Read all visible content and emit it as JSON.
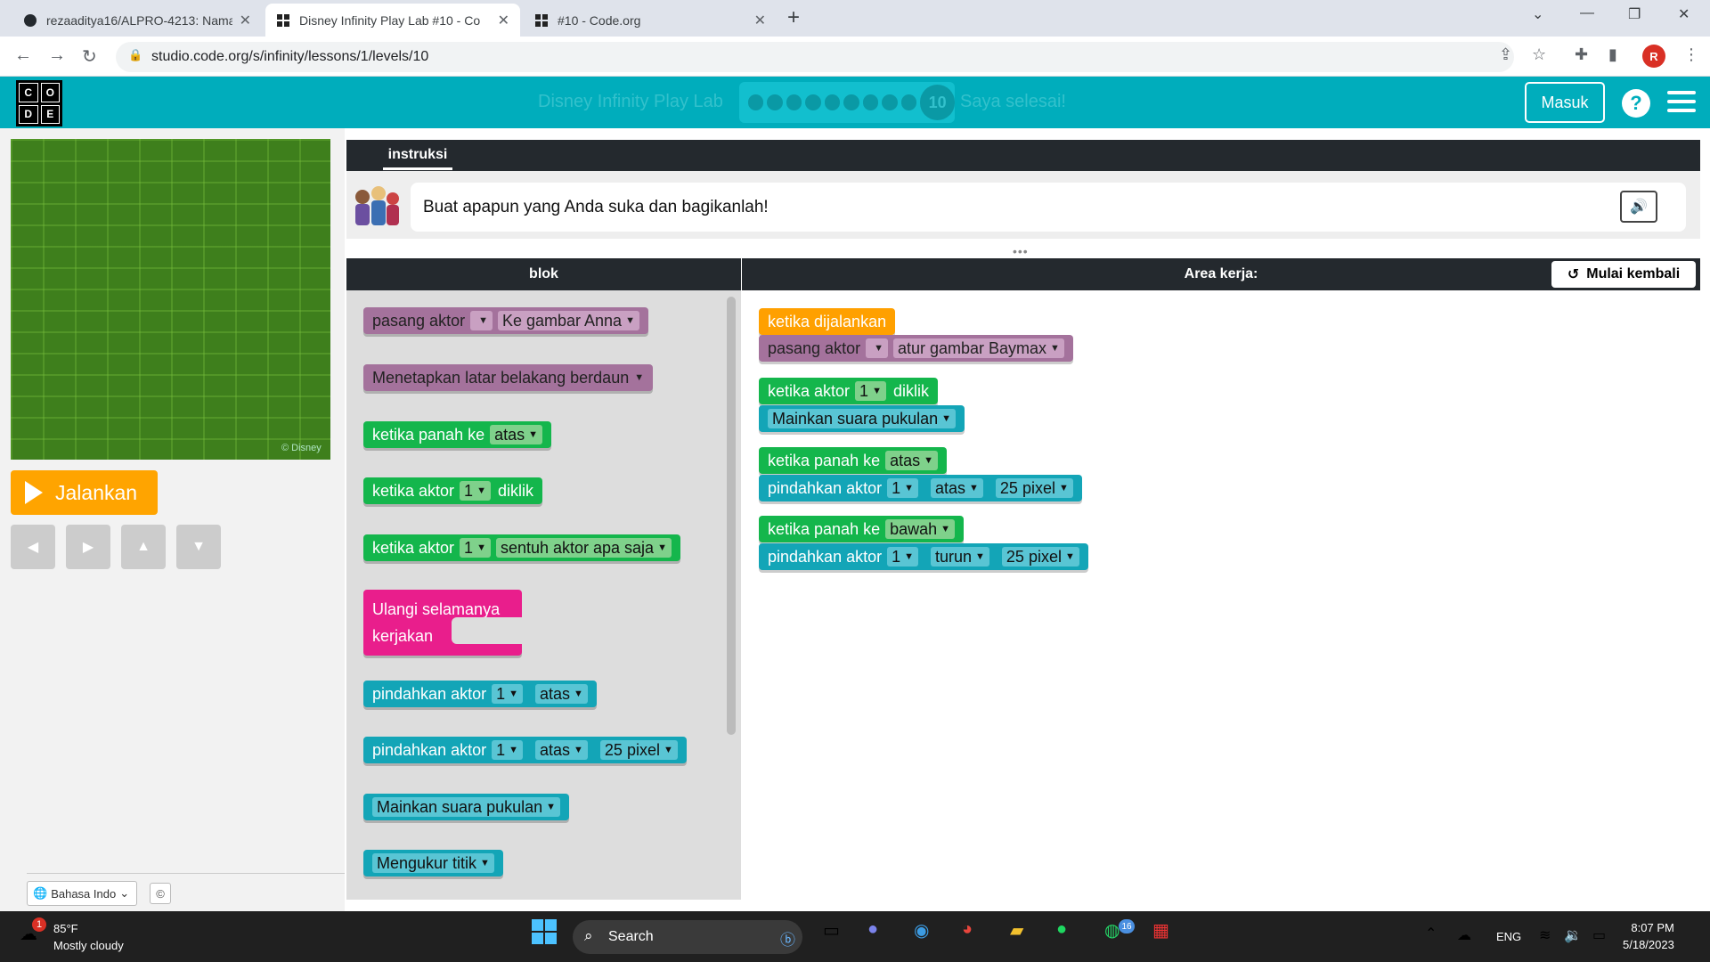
{
  "browser": {
    "tabs": [
      {
        "title": "rezaaditya16/ALPRO-4213: Nama",
        "icon": "github-icon",
        "active": false
      },
      {
        "title": "Disney Infinity Play Lab #10 - Co",
        "icon": "code-org-icon",
        "active": true
      },
      {
        "title": "#10 - Code.org",
        "icon": "code-org-icon",
        "active": false
      }
    ],
    "url": "studio.code.org/s/infinity/lessons/1/levels/10",
    "profile_initial": "R"
  },
  "header": {
    "logo_letters": [
      "C",
      "O",
      "D",
      "E"
    ],
    "level_title": "Disney Infinity Play Lab",
    "current_level": "10",
    "finished_label": "Saya selesai!",
    "signin_label": "Masuk",
    "help_label": "?"
  },
  "left": {
    "stage_credit": "© Disney",
    "run_label": "Jalankan",
    "language": "Bahasa Indo",
    "copyright_icon": "©"
  },
  "instructions": {
    "tab_label": "instruksi",
    "text": "Buat apapun yang Anda suka dan bagikanlah!"
  },
  "toolbox": {
    "title": "blok",
    "blocks": [
      {
        "color": "purple",
        "text": "pasang aktor",
        "slots": [
          "",
          "Ke gambar Anna"
        ]
      },
      {
        "color": "purple",
        "text": "Menetapkan latar belakang berdaun",
        "slots": []
      },
      {
        "color": "green",
        "text": "ketika  panah ke",
        "slots": [
          "atas"
        ]
      },
      {
        "color": "green",
        "text": "ketika aktor",
        "slots": [
          "1",
          "diklik"
        ]
      },
      {
        "color": "green",
        "text": "ketika aktor",
        "slots": [
          "1",
          "sentuh aktor apa saja"
        ]
      },
      {
        "color": "pink",
        "text": "Ulangi selamanya",
        "text2": "kerjakan",
        "slots": []
      },
      {
        "color": "teal",
        "text": "pindahkan aktor",
        "slots": [
          "1",
          "atas"
        ]
      },
      {
        "color": "teal",
        "text": "pindahkan aktor",
        "slots": [
          "1",
          "atas",
          "25 pixel"
        ]
      },
      {
        "color": "teal",
        "text": "Mainkan suara pukulan",
        "slots": []
      },
      {
        "color": "teal",
        "text": "Mengukur titik",
        "slots": []
      }
    ]
  },
  "workspace": {
    "title": "Area kerja:",
    "reset_label": "Mulai kembali",
    "blocks": [
      {
        "head": "ketika dijalankan",
        "body": "pasang aktor",
        "slots": [
          "",
          "atur gambar Baymax"
        ]
      },
      {
        "head": "ketika aktor",
        "head_slots": [
          "1",
          "diklik"
        ],
        "body": "Mainkan suara pukulan"
      },
      {
        "head": "ketika  panah ke",
        "head_slots": [
          "atas"
        ],
        "body": "pindahkan aktor",
        "slots": [
          "1",
          "atas",
          "25 pixel"
        ]
      },
      {
        "head": "ketika  panah ke",
        "head_slots": [
          "bawah"
        ],
        "body": "pindahkan aktor",
        "slots": [
          "1",
          "turun",
          "25 pixel"
        ]
      }
    ]
  },
  "taskbar": {
    "weather_temp": "85°F",
    "weather_desc": "Mostly cloudy",
    "weather_badge": "1",
    "search_label": "Search",
    "lang": "ENG",
    "time": "8:07 PM",
    "date": "5/18/2023",
    "whatsapp_badge": "16"
  }
}
